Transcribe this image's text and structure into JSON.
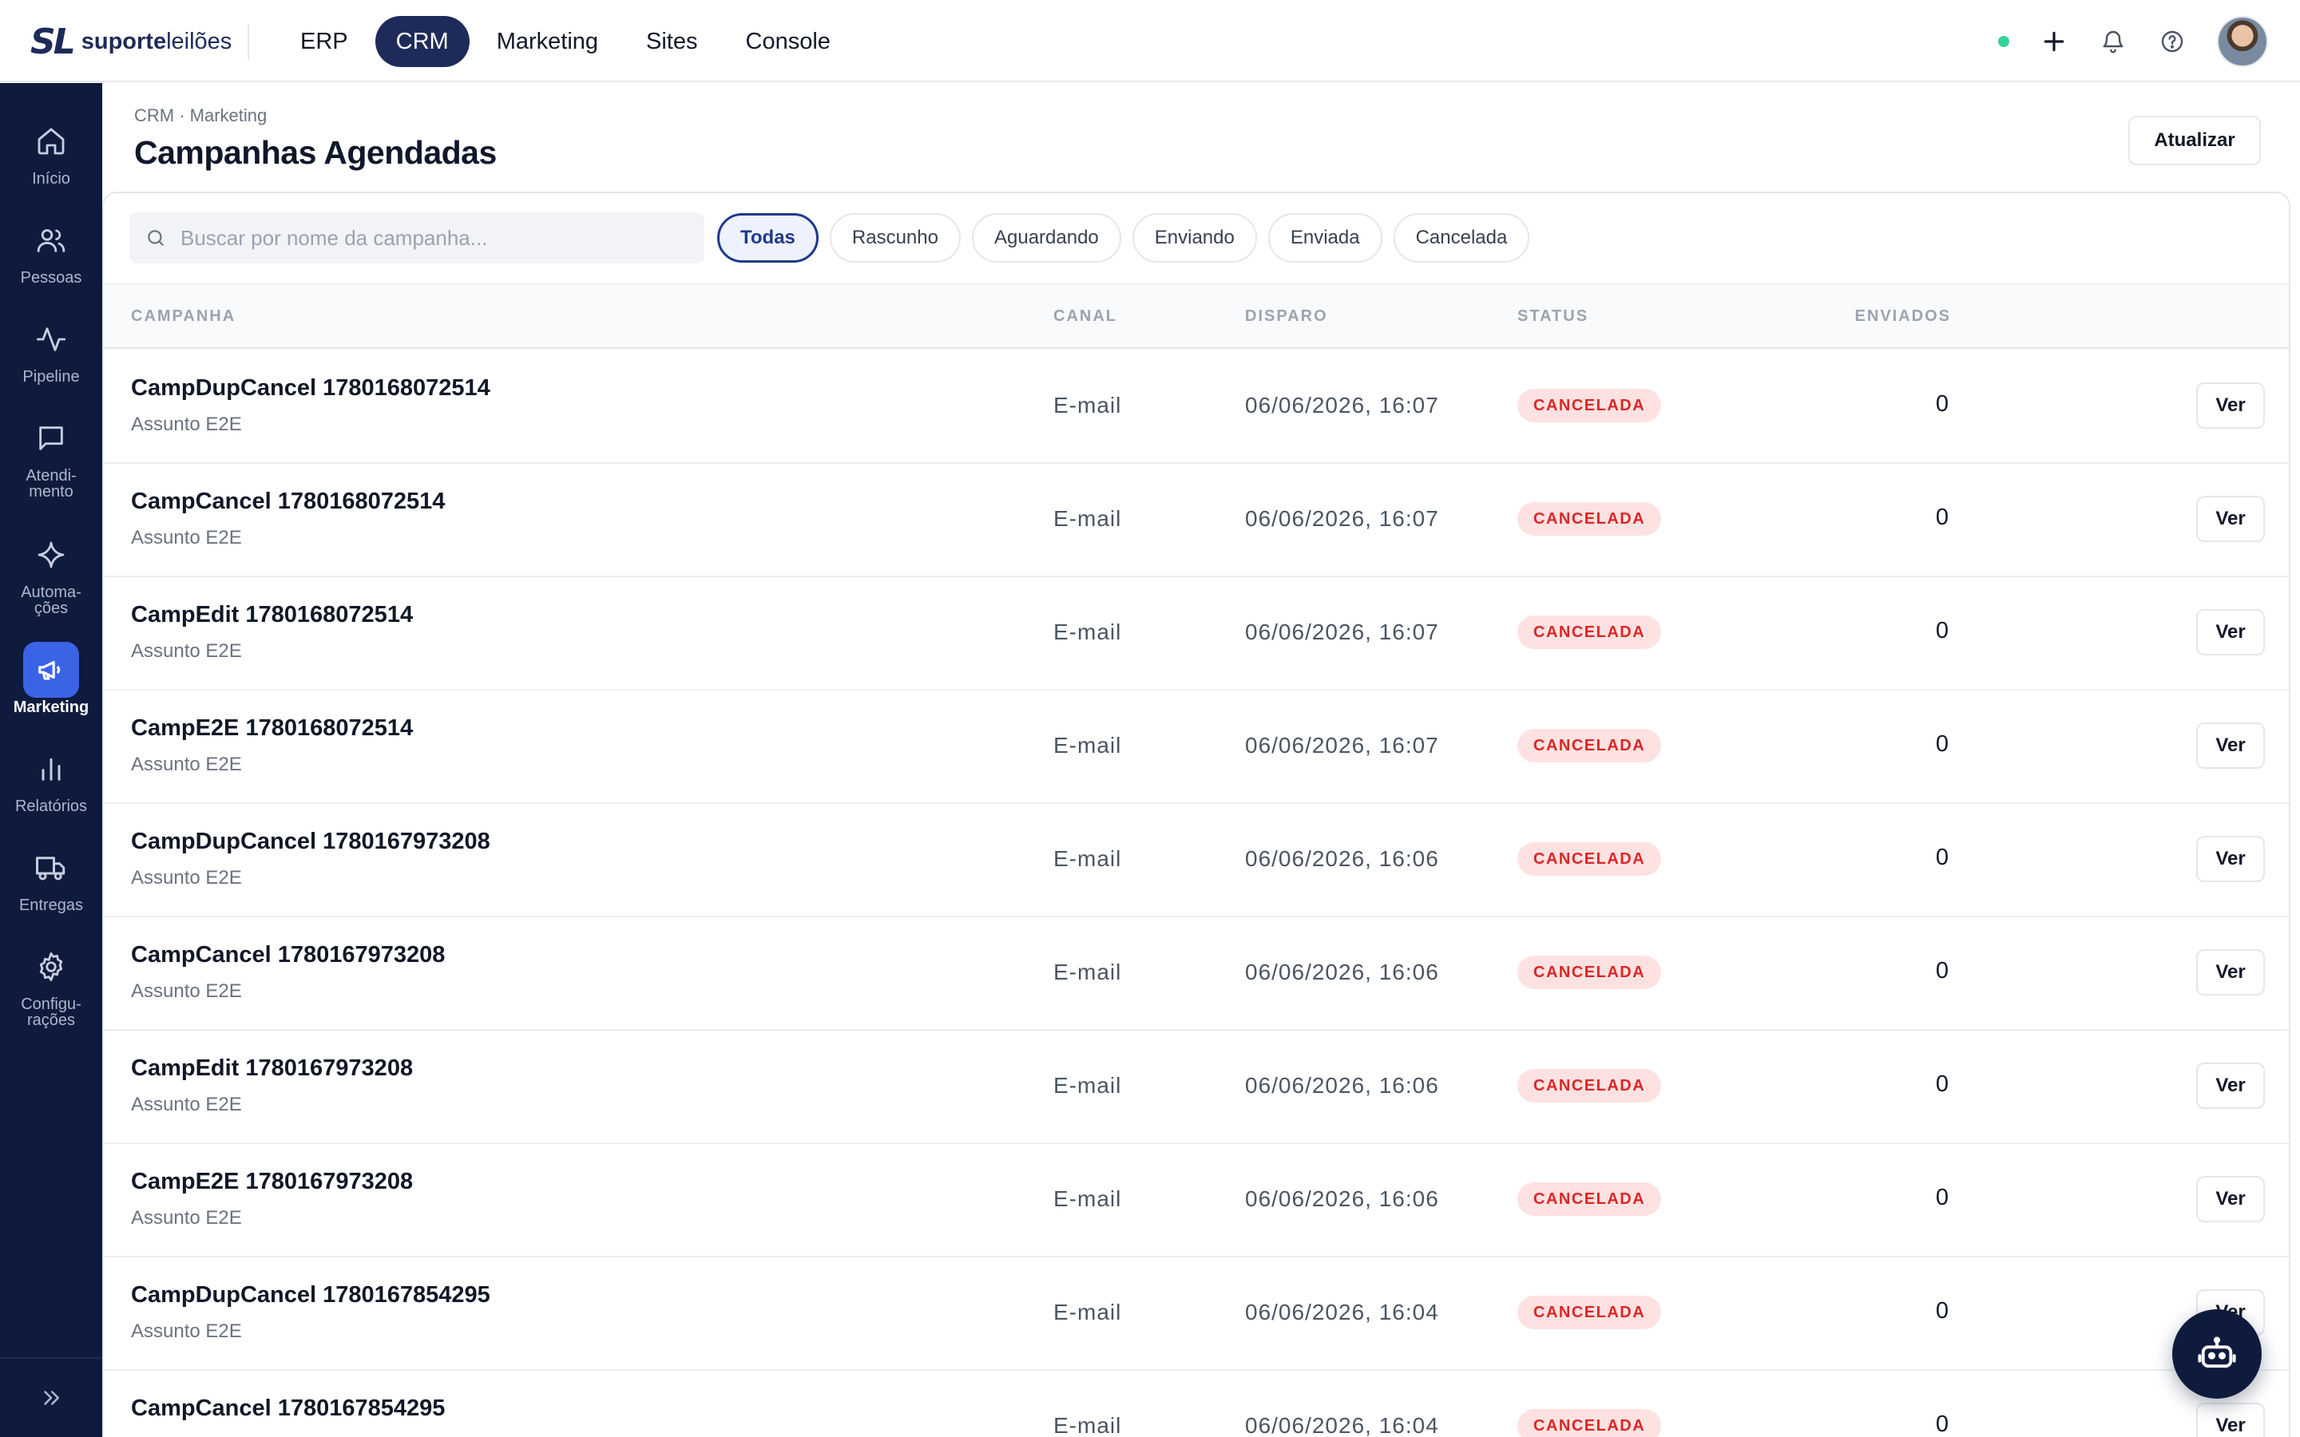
{
  "brand": {
    "mark": "SL",
    "bold": "suporte",
    "light": "leilões"
  },
  "topnav": [
    {
      "label": "ERP"
    },
    {
      "label": "CRM",
      "active": true
    },
    {
      "label": "Marketing"
    },
    {
      "label": "Sites"
    },
    {
      "label": "Console"
    }
  ],
  "sidebar": {
    "items": [
      {
        "label": "Início",
        "icon": "home-icon"
      },
      {
        "label": "Pessoas",
        "icon": "users-icon"
      },
      {
        "label": "Pipeline",
        "icon": "activity-icon"
      },
      {
        "label": "Atendi-\nmento",
        "icon": "message-icon"
      },
      {
        "label": "Automa-\nções",
        "icon": "sparkle-icon"
      },
      {
        "label": "Marketing",
        "icon": "megaphone-icon",
        "active": true
      },
      {
        "label": "Relatórios",
        "icon": "bar-chart-icon"
      },
      {
        "label": "Entregas",
        "icon": "truck-icon"
      },
      {
        "label": "Configu-\nrações",
        "icon": "gear-icon"
      }
    ]
  },
  "header": {
    "breadcrumb": "CRM · Marketing",
    "title": "Campanhas Agendadas",
    "refresh_label": "Atualizar"
  },
  "search": {
    "placeholder": "Buscar por nome da campanha...",
    "value": ""
  },
  "filters": [
    {
      "label": "Todas",
      "active": true
    },
    {
      "label": "Rascunho"
    },
    {
      "label": "Aguardando"
    },
    {
      "label": "Enviando"
    },
    {
      "label": "Enviada"
    },
    {
      "label": "Cancelada"
    }
  ],
  "table": {
    "columns": {
      "campanha": "CAMPANHA",
      "canal": "CANAL",
      "disparo": "DISPARO",
      "status": "STATUS",
      "enviados": "ENVIADOS"
    },
    "action_label": "Ver",
    "rows": [
      {
        "name": "CampDupCancel 1780168072514",
        "subject": "Assunto E2E",
        "canal": "E-mail",
        "disparo": "06/06/2026, 16:07",
        "status": "CANCELADA",
        "enviados": "0"
      },
      {
        "name": "CampCancel 1780168072514",
        "subject": "Assunto E2E",
        "canal": "E-mail",
        "disparo": "06/06/2026, 16:07",
        "status": "CANCELADA",
        "enviados": "0"
      },
      {
        "name": "CampEdit 1780168072514",
        "subject": "Assunto E2E",
        "canal": "E-mail",
        "disparo": "06/06/2026, 16:07",
        "status": "CANCELADA",
        "enviados": "0"
      },
      {
        "name": "CampE2E 1780168072514",
        "subject": "Assunto E2E",
        "canal": "E-mail",
        "disparo": "06/06/2026, 16:07",
        "status": "CANCELADA",
        "enviados": "0"
      },
      {
        "name": "CampDupCancel 1780167973208",
        "subject": "Assunto E2E",
        "canal": "E-mail",
        "disparo": "06/06/2026, 16:06",
        "status": "CANCELADA",
        "enviados": "0"
      },
      {
        "name": "CampCancel 1780167973208",
        "subject": "Assunto E2E",
        "canal": "E-mail",
        "disparo": "06/06/2026, 16:06",
        "status": "CANCELADA",
        "enviados": "0"
      },
      {
        "name": "CampEdit 1780167973208",
        "subject": "Assunto E2E",
        "canal": "E-mail",
        "disparo": "06/06/2026, 16:06",
        "status": "CANCELADA",
        "enviados": "0"
      },
      {
        "name": "CampE2E 1780167973208",
        "subject": "Assunto E2E",
        "canal": "E-mail",
        "disparo": "06/06/2026, 16:06",
        "status": "CANCELADA",
        "enviados": "0"
      },
      {
        "name": "CampDupCancel 1780167854295",
        "subject": "Assunto E2E",
        "canal": "E-mail",
        "disparo": "06/06/2026, 16:04",
        "status": "CANCELADA",
        "enviados": "0"
      },
      {
        "name": "CampCancel 1780167854295",
        "subject": "",
        "canal": "E-mail",
        "disparo": "06/06/2026, 16:04",
        "status": "CANCELADA",
        "enviados": "0"
      }
    ]
  },
  "colors": {
    "navy": "#0f1b3d",
    "accent": "#3b63e6",
    "danger": "#dc2626",
    "success": "#34d399"
  }
}
